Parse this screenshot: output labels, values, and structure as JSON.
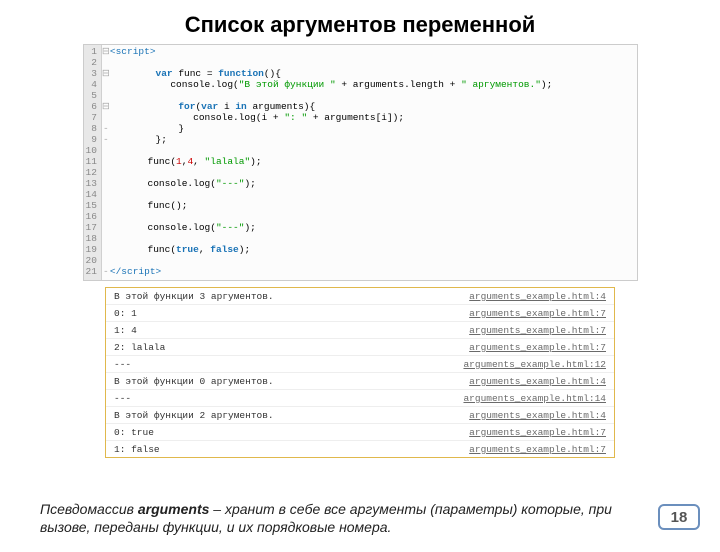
{
  "title": "Список аргументов переменной",
  "code": {
    "gutter": [
      "1",
      "2",
      "3",
      "4",
      "5",
      "6",
      "7",
      "8",
      "9",
      "10",
      "11",
      "12",
      "13",
      "14",
      "15",
      "16",
      "17",
      "18",
      "19",
      "20",
      "21"
    ],
    "line1": "<script>",
    "line3a": "var",
    "line3b": " func = ",
    "line3c": "function",
    "line3d": "(){",
    "line4a": "            console.log(",
    "line4b": "\"В этой функции \"",
    "line4c": " + arguments.length + ",
    "line4d": "\" аргументов.\"",
    "line4e": ");",
    "line6a": "for",
    "line6b": "(",
    "line6c": "var",
    "line6d": " i ",
    "line6e": "in",
    "line6f": " arguments){",
    "line7a": "                console.log(i + ",
    "line7b": "\": \"",
    "line7c": " + arguments[i]);",
    "line8": "            }",
    "line9": "        };",
    "line11a": "        func(",
    "line11b": "1",
    "line11c": ",",
    "line11d": "4",
    "line11e": ", ",
    "line11f": "\"lalala\"",
    "line11g": ");",
    "line13a": "        console.log(",
    "line13b": "\"---\"",
    "line13c": ");",
    "line15": "        func();",
    "line17a": "        console.log(",
    "line17b": "\"---\"",
    "line17c": ");",
    "line19a": "        func(",
    "line19b": "true",
    "line19c": ", ",
    "line19d": "false",
    "line19e": ");",
    "line21": "</script>"
  },
  "console": [
    {
      "msg": "В этой функции 3 аргументов.",
      "src": "arguments_example.html:4"
    },
    {
      "msg": "0: 1",
      "src": "arguments_example.html:7"
    },
    {
      "msg": "1: 4",
      "src": "arguments_example.html:7"
    },
    {
      "msg": "2: lalala",
      "src": "arguments_example.html:7"
    },
    {
      "msg": "---",
      "src": "arguments_example.html:12"
    },
    {
      "msg": "В этой функции 0 аргументов.",
      "src": "arguments_example.html:4"
    },
    {
      "msg": "---",
      "src": "arguments_example.html:14"
    },
    {
      "msg": "В этой функции 2 аргументов.",
      "src": "arguments_example.html:4"
    },
    {
      "msg": "0: true",
      "src": "arguments_example.html:7"
    },
    {
      "msg": "1: false",
      "src": "arguments_example.html:7"
    }
  ],
  "footer": {
    "pre": "Псевдомассив ",
    "bold": "arguments",
    "post": " – хранит в себе все аргументы (параметры) которые, при вызове, переданы функции, и их порядковые номера."
  },
  "page": "18"
}
